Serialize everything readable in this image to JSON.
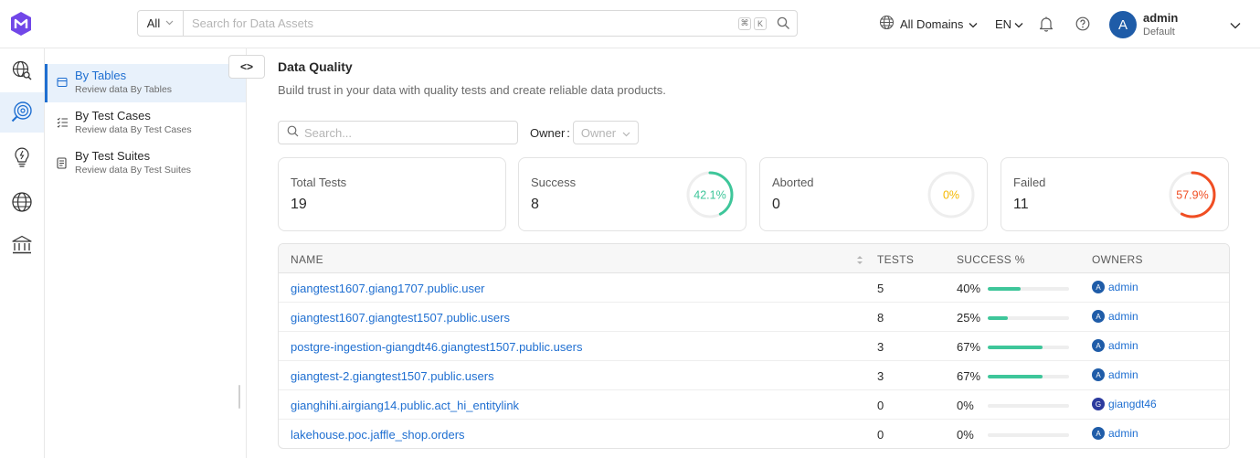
{
  "header": {
    "search_filter": "All",
    "search_placeholder": "Search for Data Assets",
    "shortcut_keys": [
      "⌘",
      "K"
    ],
    "domains_label": "All Domains",
    "language": "EN",
    "user": {
      "initial": "A",
      "name": "admin",
      "role": "Default"
    }
  },
  "rail": {
    "icons": [
      "explore-icon",
      "observability-icon",
      "insights-icon",
      "domains-icon",
      "governance-icon"
    ],
    "active_index": 1
  },
  "subnav": {
    "items": [
      {
        "title": "By Tables",
        "subtitle": "Review data By Tables",
        "icon": "table-icon",
        "active": true
      },
      {
        "title": "By Test Cases",
        "subtitle": "Review data By Test Cases",
        "icon": "test-case-icon",
        "active": false
      },
      {
        "title": "By Test Suites",
        "subtitle": "Review data By Test Suites",
        "icon": "test-suite-icon",
        "active": false
      }
    ],
    "collapse_label": "<>"
  },
  "main": {
    "title": "Data Quality",
    "subtitle": "Build trust in your data with quality tests and create reliable data products.",
    "search_placeholder": "Search...",
    "owner_label": "Owner",
    "owner_separator": ":",
    "owner_placeholder": "Owner"
  },
  "summary": {
    "cards": [
      {
        "label": "Total Tests",
        "value": "19"
      },
      {
        "label": "Success",
        "value": "8",
        "percent_text": "42.1%",
        "percent": 42.1,
        "color": "#3ec69a"
      },
      {
        "label": "Aborted",
        "value": "0",
        "percent_text": "0%",
        "percent": 0,
        "color": "#f5b800"
      },
      {
        "label": "Failed",
        "value": "11",
        "percent_text": "57.9%",
        "percent": 57.9,
        "color": "#f04e23"
      }
    ]
  },
  "table": {
    "columns": [
      "NAME",
      "TESTS",
      "SUCCESS %",
      "OWNERS"
    ],
    "rows": [
      {
        "name": "giangtest1607.giang1707.public.user",
        "tests": "5",
        "success": "40%",
        "success_value": 40,
        "owner_initial": "A",
        "owner": "admin",
        "owner_color": "#1f5ca8"
      },
      {
        "name": "giangtest1607.giangtest1507.public.users",
        "tests": "8",
        "success": "25%",
        "success_value": 25,
        "owner_initial": "A",
        "owner": "admin",
        "owner_color": "#1f5ca8"
      },
      {
        "name": "postgre-ingestion-giangdt46.giangtest1507.public.users",
        "tests": "3",
        "success": "67%",
        "success_value": 67,
        "owner_initial": "A",
        "owner": "admin",
        "owner_color": "#1f5ca8"
      },
      {
        "name": "giangtest-2.giangtest1507.public.users",
        "tests": "3",
        "success": "67%",
        "success_value": 67,
        "owner_initial": "A",
        "owner": "admin",
        "owner_color": "#1f5ca8"
      },
      {
        "name": "gianghihi.airgiang14.public.act_hi_entitylink",
        "tests": "0",
        "success": "0%",
        "success_value": 0,
        "owner_initial": "G",
        "owner": "giangdt46",
        "owner_color": "#2b3a9e"
      },
      {
        "name": "lakehouse.poc.jaffle_shop.orders",
        "tests": "0",
        "success": "0%",
        "success_value": 0,
        "owner_initial": "A",
        "owner": "admin",
        "owner_color": "#1f5ca8"
      }
    ]
  },
  "colors": {
    "accent": "#1f6fd1",
    "success": "#3ec69a",
    "warning": "#f5b800",
    "danger": "#f04e23",
    "brand": "#7147e8"
  }
}
